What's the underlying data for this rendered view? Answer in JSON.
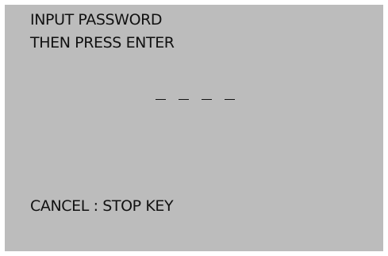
{
  "prompt": {
    "line1": "INPUT PASSWORD",
    "line2": "THEN PRESS ENTER"
  },
  "password": {
    "slots": [
      "",
      "",
      "",
      ""
    ]
  },
  "footer": {
    "cancel_hint": "CANCEL : STOP KEY"
  }
}
